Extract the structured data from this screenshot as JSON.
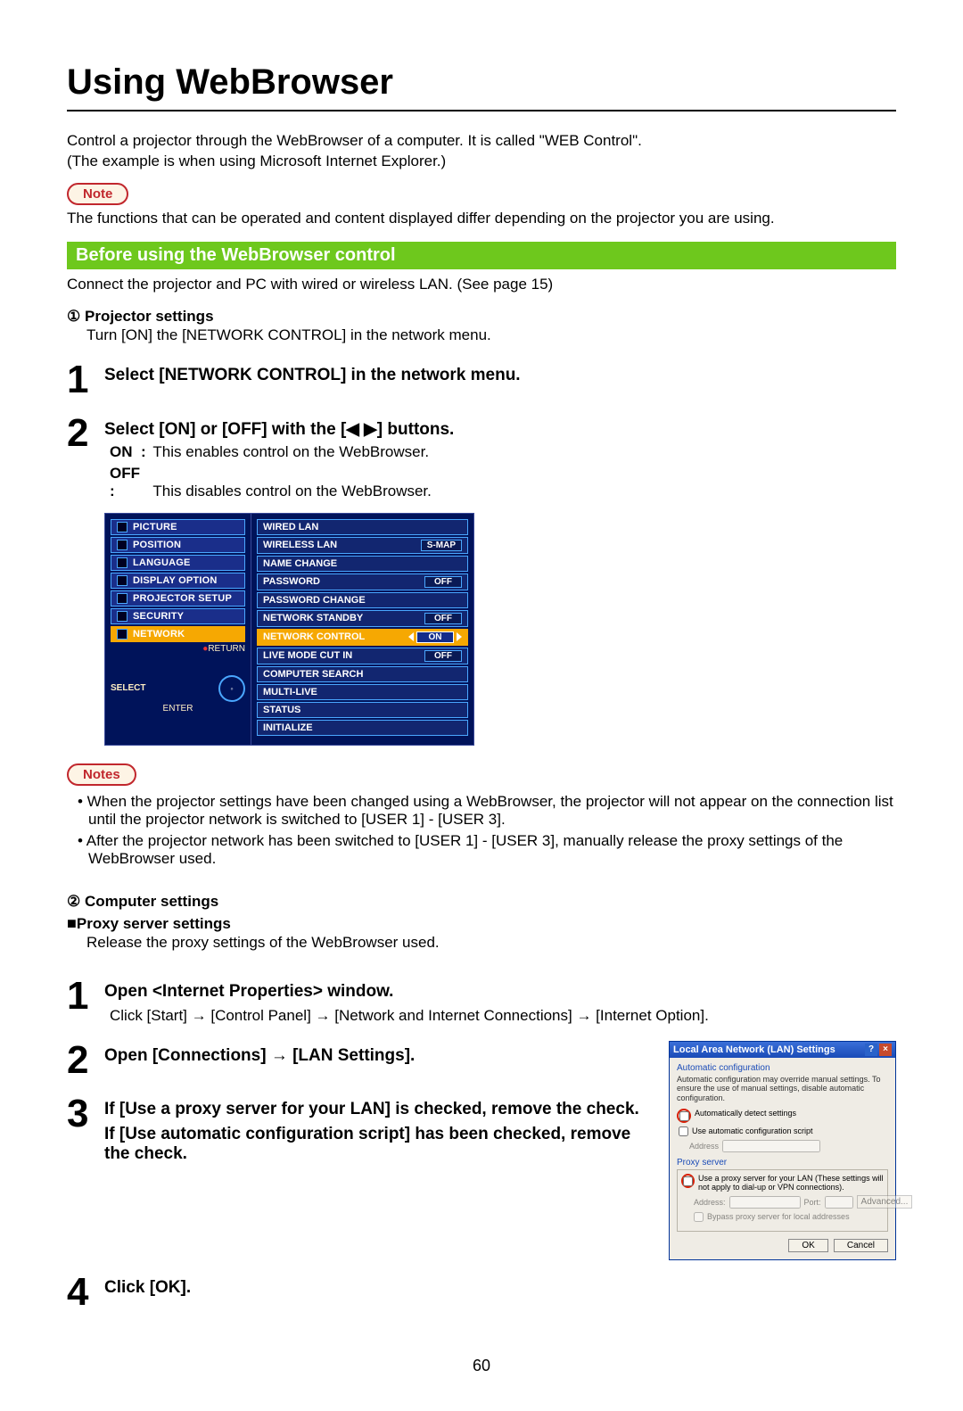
{
  "page": {
    "title": "Using WebBrowser",
    "intro1": "Control a projector through the WebBrowser of a computer. It is called \"WEB Control\".",
    "intro2": "(The example is when using Microsoft Internet Explorer.)",
    "noteLabel": "Note",
    "notesLabel": "Notes",
    "noteText": "The functions that can be operated and content displayed differ depending on the projector you are using.",
    "sectionBar": "Before using the WebBrowser control",
    "sectionText": "Connect the projector and PC with wired or wireless LAN. (See page 15)",
    "sub1": "Projector settings",
    "sub1Num": "①",
    "sub1Text": "Turn [ON] the [NETWORK CONTROL] in the network menu.",
    "step1": {
      "num": "1",
      "title": "Select [NETWORK CONTROL] in the network menu."
    },
    "step2": {
      "num": "2",
      "title_a": "Select [ON] or [OFF] with the [",
      "title_b": "] buttons.",
      "arrows": "◀ ▶",
      "on": "ON",
      "onText": "This enables control on the WebBrowser.",
      "off": "OFF :",
      "offText": "This disables control on the WebBrowser."
    },
    "osd": {
      "left": [
        "PICTURE",
        "POSITION",
        "LANGUAGE",
        "DISPLAY OPTION",
        "PROJECTOR SETUP",
        "SECURITY",
        "NETWORK"
      ],
      "leftSelected": "NETWORK",
      "select": "SELECT",
      "enter": "ENTER",
      "return": "RETURN",
      "right": [
        {
          "label": "WIRED LAN",
          "val": ""
        },
        {
          "label": "WIRELESS LAN",
          "val": "S-MAP"
        },
        {
          "label": "NAME CHANGE",
          "val": ""
        },
        {
          "label": "PASSWORD",
          "val": "OFF"
        },
        {
          "label": "PASSWORD CHANGE",
          "val": ""
        },
        {
          "label": "NETWORK STANDBY",
          "val": "OFF"
        },
        {
          "label": "NETWORK CONTROL",
          "val": "ON",
          "sel": true
        },
        {
          "label": "LIVE MODE CUT IN",
          "val": "OFF"
        },
        {
          "label": "COMPUTER SEARCH",
          "val": ""
        },
        {
          "label": "MULTI-LIVE",
          "val": ""
        },
        {
          "label": "STATUS",
          "val": ""
        },
        {
          "label": "INITIALIZE",
          "val": ""
        }
      ]
    },
    "notesBullets": [
      "When the projector settings have been changed using a WebBrowser, the projector will not appear on the connection list until the projector network is switched to [USER 1] - [USER 3].",
      "After the projector network has been switched to [USER 1] - [USER 3], manually release the proxy settings of the WebBrowser used."
    ],
    "sub2Num": "②",
    "sub2": "Computer settings",
    "proxyHeading": "Proxy server settings",
    "proxyBox": "■",
    "proxyText": "Release the proxy settings of the WebBrowser used.",
    "proxySteps": {
      "s1": {
        "num": "1",
        "title": "Open <Internet Properties> window.",
        "text": "Click [Start] → [Control Panel] → [Network and Internet Connections] → [Internet Option]."
      },
      "s2": {
        "num": "2",
        "title": "Open [Connections] → [LAN Settings]."
      },
      "s3": {
        "num": "3",
        "title": "If [Use a proxy server for your LAN] is checked, remove the check.",
        "title2": "If [Use automatic configuration script] has been checked, remove the check."
      },
      "s4": {
        "num": "4",
        "title": "Click [OK]."
      }
    },
    "lanDialog": {
      "title": "Local Area Network (LAN) Settings",
      "h1": "Automatic configuration",
      "txt1": "Automatic configuration may override manual settings. To ensure the use of manual settings, disable automatic configuration.",
      "chk1": "Automatically detect settings",
      "chk2": "Use automatic configuration script",
      "addr": "Address",
      "h2": "Proxy server",
      "chk3": "Use a proxy server for your LAN (These settings will not apply to dial-up or VPN connections).",
      "addrL": "Address:",
      "port": "Port:",
      "adv": "Advanced...",
      "bypass": "Bypass proxy server for local addresses",
      "ok": "OK",
      "cancel": "Cancel"
    },
    "pageNum": "60"
  }
}
